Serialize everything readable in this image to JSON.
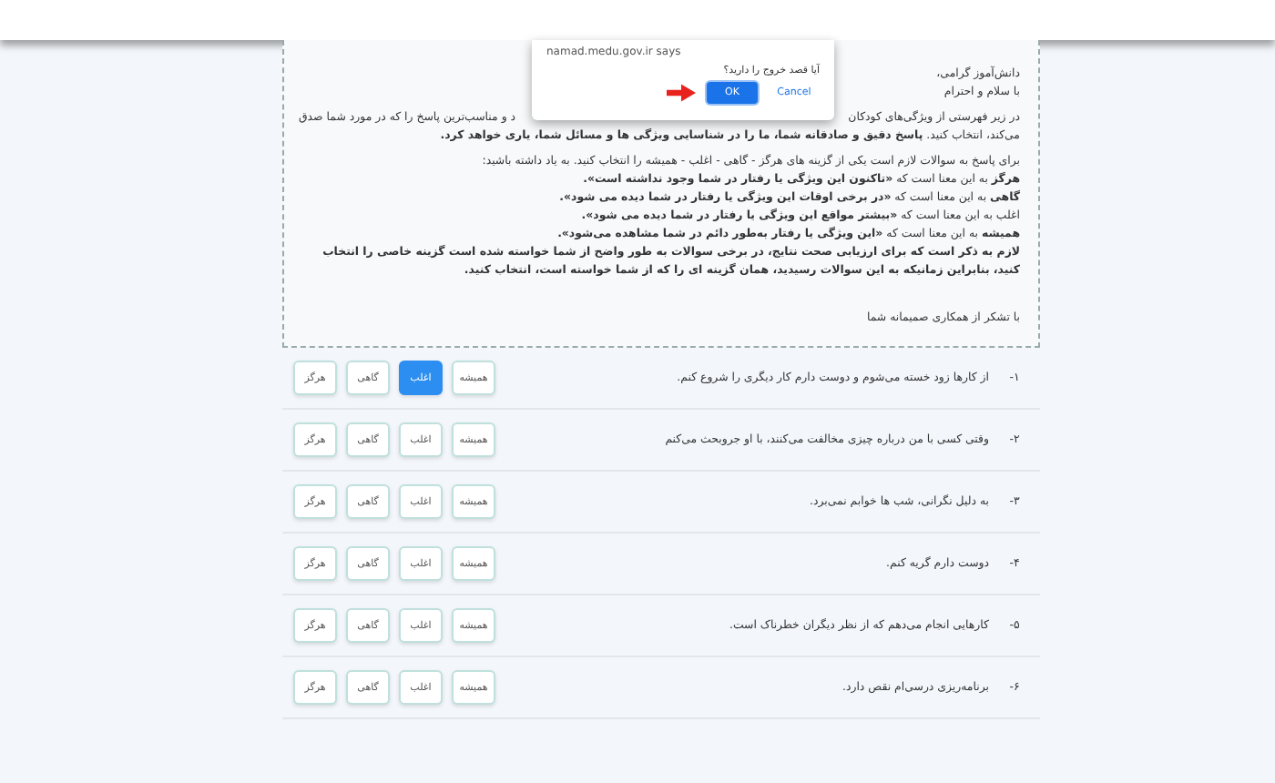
{
  "dialog": {
    "origin": "namad.medu.gov.ir says",
    "message": "آیا قصد خروج را دارید؟",
    "buttons": [
      {
        "label": "Cancel",
        "kind": "plain"
      },
      {
        "label": "OK",
        "kind": "primary"
      }
    ]
  },
  "intro": {
    "greeting": [
      "دانش‌آموز گرامی،",
      "با سلام و احترام"
    ],
    "lead_parts": [
      "در زیر فهرستی از ویژگی‌های کودکان",
      "د و مناسب‌ترین پاسخ را که در مورد شما صدق"
    ],
    "lead_end": "می‌کند، انتخاب کنید. **پاسخ دقیق و صادقانه شما، ما را در شناسایی ویژگی ها و مسائل شما، یاری خواهد کرد.**",
    "guide": "برای پاسخ به سوالات لازم است یکی از گزینه های هرگز - گاهی - اغلب - همیشه را انتخاب کنید.  به یاد داشته باشید:",
    "meanings": [
      "**هرگز** به این معنا است که **«تاکنون این ویژگی یا رفتار در شما وجود نداشته است».**",
      "**گاهی** به این معنا است که **«در برخی اوقات این ویژگی یا رفتار در شما دیده می شود».**",
      "اغلب به این معنا است که **«بیشتر مواقع این ویژگی یا رفتار در شما دیده می شود».**",
      "**همیشه** به این معنا است که **«این ویژگی یا رفتار به‌طور دائم در شما مشاهده می‌شود».**"
    ],
    "note": "لازم به ذکر است که برای ارزیابی صحت نتایج، در برخی سوالات به طور واضح از شما خواسته شده است گزینه خاصی را انتخاب کنید، بنابراین زمانیکه به این سوالات رسیدید، همان گزینه ای را که از شما خواسته است، انتخاب کنید.",
    "thanks": "با تشکر از همکاری صمیمانه شما"
  },
  "questions": [
    {
      "number": "۱-",
      "text": "از کارها زود خسته می‌شوم و دوست دارم کار دیگری را شروع کنم.",
      "options": [
        {
          "label": "همیشه",
          "selected": false
        },
        {
          "label": "اغلب",
          "selected": true
        },
        {
          "label": "گاهی",
          "selected": false
        },
        {
          "label": "هرگز",
          "selected": false
        }
      ]
    },
    {
      "number": "۲-",
      "text": "وقتی کسی با من درباره چیزی مخالفت می‌کنند، با او جروبحث می‌کنم",
      "options": [
        {
          "label": "همیشه",
          "selected": false
        },
        {
          "label": "اغلب",
          "selected": false
        },
        {
          "label": "گاهی",
          "selected": false
        },
        {
          "label": "هرگز",
          "selected": false
        }
      ]
    },
    {
      "number": "۳-",
      "text": "به دلیل نگرانی، شب ها خوابم نمی‌برد.",
      "options": [
        {
          "label": "همیشه",
          "selected": false
        },
        {
          "label": "اغلب",
          "selected": false
        },
        {
          "label": "گاهی",
          "selected": false
        },
        {
          "label": "هرگز",
          "selected": false
        }
      ]
    },
    {
      "number": "۴-",
      "text": "دوست دارم گریه کنم.",
      "options": [
        {
          "label": "همیشه",
          "selected": false
        },
        {
          "label": "اغلب",
          "selected": false
        },
        {
          "label": "گاهی",
          "selected": false
        },
        {
          "label": "هرگز",
          "selected": false
        }
      ]
    },
    {
      "number": "۵-",
      "text": "کارهایی انجام می‌دهم که از نظر دیگران خطرناک است.",
      "options": [
        {
          "label": "همیشه",
          "selected": false
        },
        {
          "label": "اغلب",
          "selected": false
        },
        {
          "label": "گاهی",
          "selected": false
        },
        {
          "label": "هرگز",
          "selected": false
        }
      ]
    },
    {
      "number": "۶-",
      "text": "برنامه‌ریزی درسی‌ام نقص دارد.",
      "options": [
        {
          "label": "همیشه",
          "selected": false
        },
        {
          "label": "اغلب",
          "selected": false
        },
        {
          "label": "گاهی",
          "selected": false
        },
        {
          "label": "هرگز",
          "selected": false
        }
      ]
    }
  ]
}
